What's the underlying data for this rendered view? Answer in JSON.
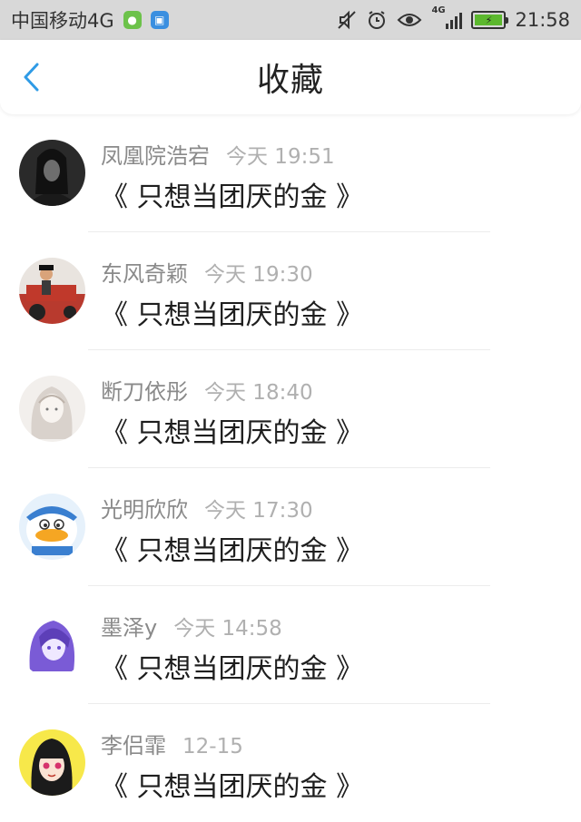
{
  "status_bar": {
    "carrier": "中国移动4G",
    "network_small": "4G",
    "time": "21:58"
  },
  "header": {
    "title": "收藏"
  },
  "favorites": [
    {
      "name": "凤凰院浩宕",
      "time": "今天 19:51",
      "content": "《 只想当团厌的金 》"
    },
    {
      "name": "东风奇颖",
      "time": "今天 19:30",
      "content": "《 只想当团厌的金 》"
    },
    {
      "name": "断刀依彤",
      "time": "今天 18:40",
      "content": "《 只想当团厌的金 》"
    },
    {
      "name": "光明欣欣",
      "time": "今天 17:30",
      "content": "《 只想当团厌的金 》"
    },
    {
      "name": "墨泽y",
      "time": "今天 14:58",
      "content": "《 只想当团厌的金 》"
    },
    {
      "name": "李侣霏",
      "time": "12-15",
      "content": "《 只想当团厌的金 》"
    }
  ],
  "colors": {
    "accent": "#2f9be6",
    "name_text": "#8a8a8a",
    "time_text": "#b0b0b0",
    "content_text": "#1e1e1e"
  }
}
